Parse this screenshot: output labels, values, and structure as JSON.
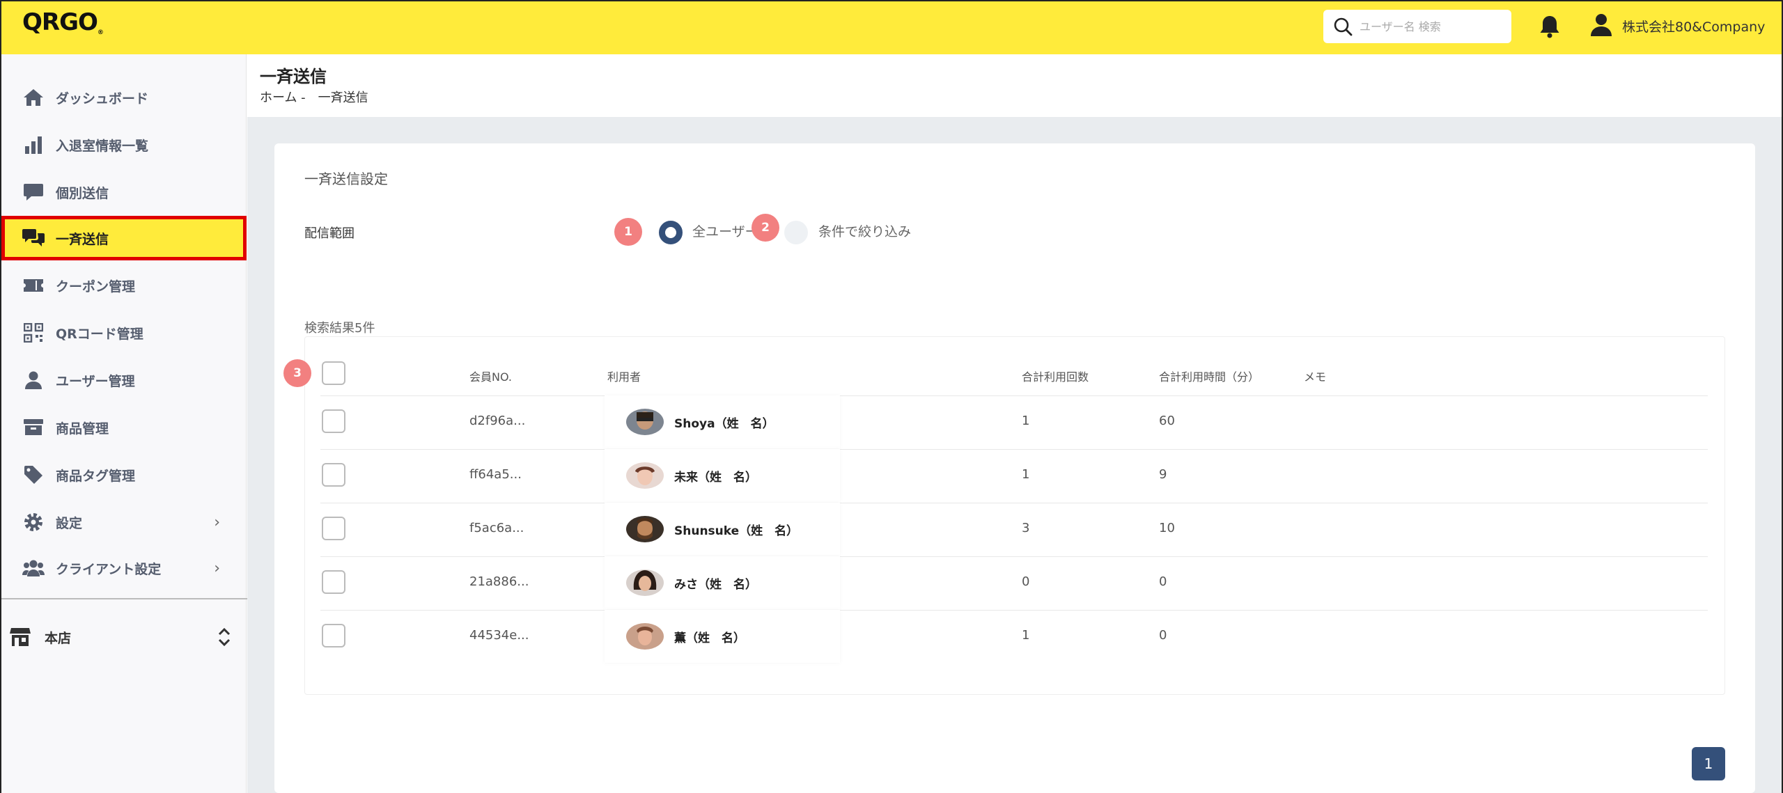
{
  "app": {
    "logo": "QRGO"
  },
  "header": {
    "search_placeholder": "ユーザー名 検索",
    "company": "株式会社80&Company"
  },
  "sidebar": {
    "items": [
      {
        "label": "ダッシュボード",
        "icon": "home-icon"
      },
      {
        "label": "入退室情報一覧",
        "icon": "bar-chart-icon"
      },
      {
        "label": "個別送信",
        "icon": "chat-bubble-icon"
      },
      {
        "label": "一斉送信",
        "icon": "chat-bubbles-icon",
        "active": true
      },
      {
        "label": "クーポン管理",
        "icon": "ticket-icon"
      },
      {
        "label": "QRコード管理",
        "icon": "qr-code-icon"
      },
      {
        "label": "ユーザー管理",
        "icon": "user-icon"
      },
      {
        "label": "商品管理",
        "icon": "archive-box-icon"
      },
      {
        "label": "商品タグ管理",
        "icon": "tag-icon"
      },
      {
        "label": "設定",
        "icon": "gear-icon",
        "chevron": "›"
      },
      {
        "label": "クライアント設定",
        "icon": "users-icon",
        "chevron": "›"
      }
    ],
    "store": "本店"
  },
  "page": {
    "title": "一斉送信",
    "breadcrumb": "ホーム -　一斉送信"
  },
  "form": {
    "section_title": "一斉送信設定",
    "range_label": "配信範囲",
    "options": [
      {
        "label": "全ユーザー",
        "selected": true
      },
      {
        "label": "条件で絞り込み",
        "selected": false
      }
    ]
  },
  "badges": [
    "1",
    "2",
    "3"
  ],
  "results": {
    "count_text": "検索結果5件",
    "columns": [
      "会員NO.",
      "利用者",
      "合計利用回数",
      "合計利用時間（分）",
      "メモ"
    ],
    "rows": [
      {
        "member_no": "d2f96a...",
        "user": "Shoya（姓　名）",
        "count": "1",
        "minutes": "60",
        "memo": ""
      },
      {
        "member_no": "ff64a5...",
        "user": "未来（姓　名）",
        "count": "1",
        "minutes": "9",
        "memo": ""
      },
      {
        "member_no": "f5ac6a...",
        "user": "Shunsuke（姓　名）",
        "count": "3",
        "minutes": "10",
        "memo": ""
      },
      {
        "member_no": "21a886...",
        "user": "みさ（姓　名）",
        "count": "0",
        "minutes": "0",
        "memo": ""
      },
      {
        "member_no": "44534e...",
        "user": "薫（姓　名）",
        "count": "1",
        "minutes": "0",
        "memo": ""
      }
    ]
  },
  "pagination": {
    "current": "1"
  },
  "colors": {
    "brand_yellow": "#ffeb3b",
    "accent_navy": "#34507a",
    "badge_red": "#f28080",
    "highlight_border": "#e00000"
  }
}
